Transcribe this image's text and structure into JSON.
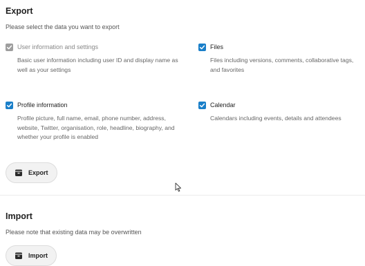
{
  "export": {
    "title": "Export",
    "description": "Please select the data you want to export",
    "button_label": "Export",
    "options": [
      {
        "label": "User information and settings",
        "help": "Basic user information including user ID and display name as well as your settings",
        "checked": true,
        "disabled": true
      },
      {
        "label": "Files",
        "help": "Files including versions, comments, collaborative tags, and favorites",
        "checked": true,
        "disabled": false
      },
      {
        "label": "Profile information",
        "help": "Profile picture, full name, email, phone number, address, website, Twitter, organisation, role, headline, biography, and whether your profile is enabled",
        "checked": true,
        "disabled": false
      },
      {
        "label": "Calendar",
        "help": "Calendars including events, details and attendees",
        "checked": true,
        "disabled": false
      }
    ]
  },
  "import": {
    "title": "Import",
    "description": "Please note that existing data may be overwritten",
    "button_label": "Import"
  },
  "colors": {
    "accent": "#1a7fc9",
    "disabled_checkbox": "#9e9e9e"
  },
  "icons": {
    "checkbox_mark": "check-icon",
    "export_button": "archive-icon",
    "import_button": "archive-icon",
    "pointer": "mouse-cursor-icon"
  }
}
